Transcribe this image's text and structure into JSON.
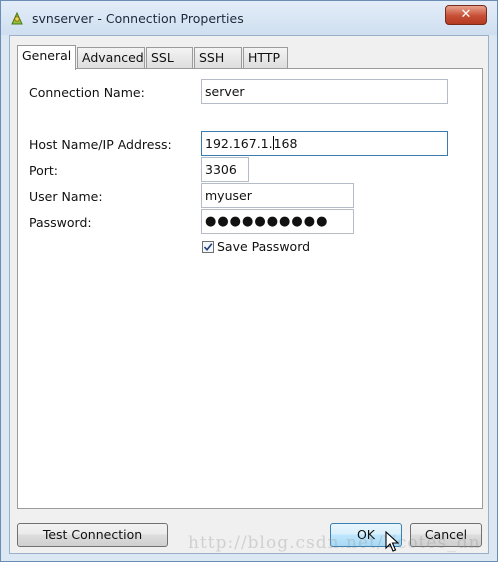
{
  "window": {
    "title": "svnserver - Connection Properties",
    "close_label": "✕"
  },
  "tabs": [
    {
      "label": "General",
      "active": true
    },
    {
      "label": "Advanced",
      "active": false
    },
    {
      "label": "SSL",
      "active": false
    },
    {
      "label": "SSH",
      "active": false
    },
    {
      "label": "HTTP",
      "active": false
    }
  ],
  "form": {
    "connection_name": {
      "label": "Connection Name:",
      "value": "server"
    },
    "host": {
      "label": "Host Name/IP Address:",
      "value_before_caret": "192.167.1.",
      "value_after_caret": "168"
    },
    "port": {
      "label": "Port:",
      "value": "3306"
    },
    "user": {
      "label": "User Name:",
      "value": "myuser"
    },
    "password": {
      "label": "Password:",
      "value": "●●●●●●●●●●"
    },
    "save_password": {
      "label": "Save Password",
      "checked": true
    }
  },
  "buttons": {
    "test_connection": "Test Connection",
    "ok": "OK",
    "cancel": "Cancel"
  },
  "watermark": "http://blog.csdn.net/Vcotes_dn",
  "colors": {
    "accent": "#3d7bad",
    "title_bg": "#cfdff0",
    "close": "#c74f36"
  }
}
